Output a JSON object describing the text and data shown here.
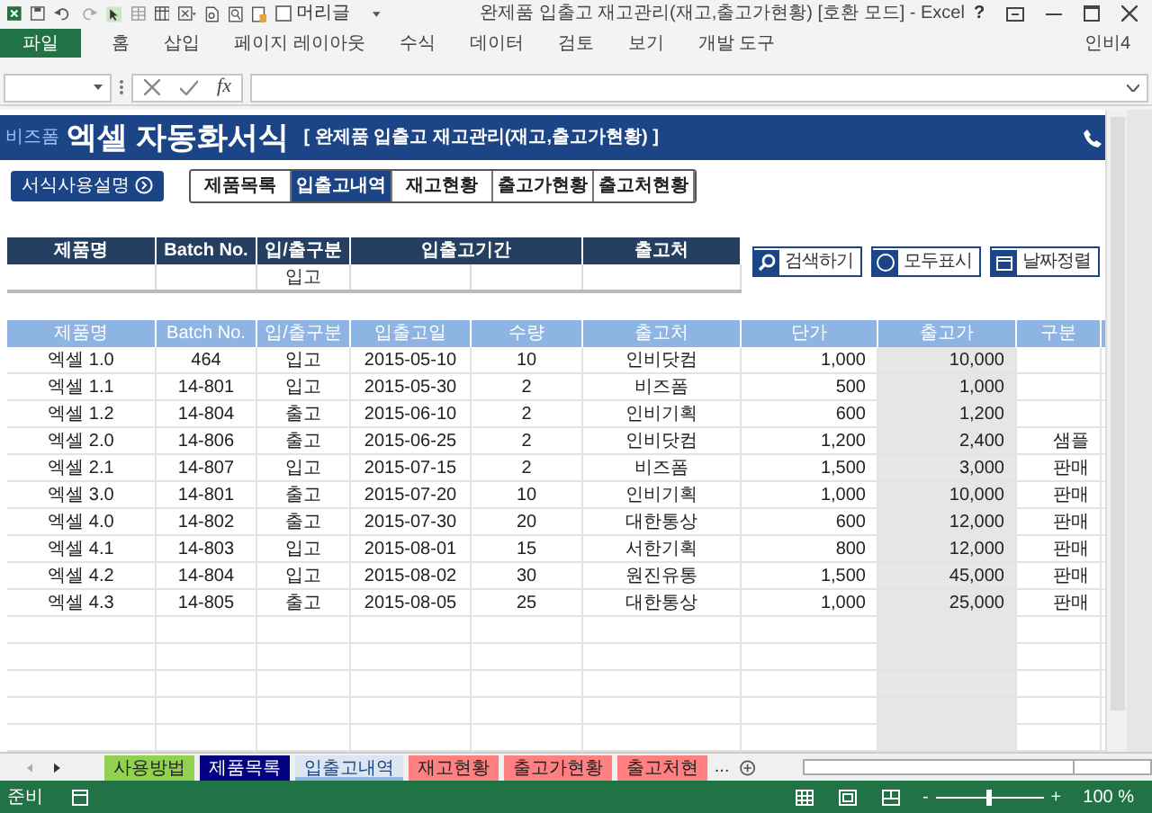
{
  "window": {
    "title": "완제품 입출고 재고관리(재고,출고가현황)  [호환 모드] - Excel",
    "quick_access": {
      "label": "머리글",
      "checked": false
    },
    "help": "?"
  },
  "ribbon": {
    "file_button": "파일",
    "tabs": [
      "홈",
      "삽입",
      "페이지 레이아웃",
      "수식",
      "데이터",
      "검토",
      "보기",
      "개발 도구"
    ],
    "account": "인비4"
  },
  "formula_bar": {
    "function_label": "fx"
  },
  "banner": {
    "logo": "비즈폼",
    "title": "엑셀 자동화서식",
    "subtitle": "[ 완제품 입출고 재고관리(재고,출고가현황) ]"
  },
  "guide_button": "서식사용설명",
  "nav_tabs": [
    {
      "label": "제품목록",
      "selected": false
    },
    {
      "label": "입출고내역",
      "selected": true
    },
    {
      "label": "재고현황",
      "selected": false
    },
    {
      "label": "출고가현황",
      "selected": false
    },
    {
      "label": "출고처현황",
      "selected": false
    }
  ],
  "search": {
    "columns": [
      "제품명",
      "Batch No.",
      "입/출구분",
      "입출고기간",
      "출고처"
    ],
    "in_out_value": "입고"
  },
  "action_buttons": [
    {
      "label": "검색하기",
      "kind": "search"
    },
    {
      "label": "모두표시",
      "kind": "all"
    },
    {
      "label": "날짜정렬",
      "kind": "date"
    }
  ],
  "table": {
    "columns": [
      "제품명",
      "Batch No.",
      "입/출구분",
      "입출고일",
      "수량",
      "출고처",
      "단가",
      "출고가",
      "구분"
    ],
    "rows": [
      {
        "product": "엑셀 1.0",
        "batch": "464",
        "in_out": "입고",
        "date": "2015-05-10",
        "qty": "10",
        "vendor": "인비닷컴",
        "unit_price": "1,000",
        "out_price": "10,000"
      },
      {
        "product": "엑셀 1.1",
        "batch": "14-801",
        "in_out": "입고",
        "date": "2015-05-30",
        "qty": "2",
        "vendor": "비즈폼",
        "unit_price": "500",
        "out_price": "1,000"
      },
      {
        "product": "엑셀 1.2",
        "batch": "14-804",
        "in_out": "출고",
        "date": "2015-06-10",
        "qty": "2",
        "vendor": "인비기획",
        "unit_price": "600",
        "out_price": "1,200"
      },
      {
        "product": "엑셀 2.0",
        "batch": "14-806",
        "in_out": "출고",
        "date": "2015-06-25",
        "qty": "2",
        "vendor": "인비닷컴",
        "unit_price": "1,200",
        "out_price": "2,400",
        "category": "샘플"
      },
      {
        "product": "엑셀 2.1",
        "batch": "14-807",
        "in_out": "입고",
        "date": "2015-07-15",
        "qty": "2",
        "vendor": "비즈폼",
        "unit_price": "1,500",
        "out_price": "3,000",
        "category": "판매"
      },
      {
        "product": "엑셀 3.0",
        "batch": "14-801",
        "in_out": "출고",
        "date": "2015-07-20",
        "qty": "10",
        "vendor": "인비기획",
        "unit_price": "1,000",
        "out_price": "10,000",
        "category": "판매"
      },
      {
        "product": "엑셀 4.0",
        "batch": "14-802",
        "in_out": "출고",
        "date": "2015-07-30",
        "qty": "20",
        "vendor": "대한통상",
        "unit_price": "600",
        "out_price": "12,000",
        "category": "판매"
      },
      {
        "product": "엑셀 4.1",
        "batch": "14-803",
        "in_out": "입고",
        "date": "2015-08-01",
        "qty": "15",
        "vendor": "서한기획",
        "unit_price": "800",
        "out_price": "12,000",
        "category": "판매"
      },
      {
        "product": "엑셀 4.2",
        "batch": "14-804",
        "in_out": "입고",
        "date": "2015-08-02",
        "qty": "30",
        "vendor": "원진유통",
        "unit_price": "1,500",
        "out_price": "45,000",
        "category": "판매"
      },
      {
        "product": "엑셀 4.3",
        "batch": "14-805",
        "in_out": "출고",
        "date": "2015-08-05",
        "qty": "25",
        "vendor": "대한통상",
        "unit_price": "1,000",
        "out_price": "25,000",
        "category": "판매"
      }
    ]
  },
  "sheet_tabs": [
    {
      "label": "사용방법",
      "color": "#92d050",
      "selected": false
    },
    {
      "label": "제품목록",
      "color": "#000080",
      "selected": false
    },
    {
      "label": "입출고내역",
      "color": "#8db4e2",
      "selected": true
    },
    {
      "label": "재고현황",
      "color": "#ff8080",
      "selected": false
    },
    {
      "label": "출고가현황",
      "color": "#ff8080",
      "selected": false
    },
    {
      "label": "출고처현",
      "color": "#ff8080",
      "selected": false
    }
  ],
  "sheet_more": "...",
  "status_bar": {
    "status": "준비",
    "zoom_out": "-",
    "zoom_slider": {
      "level": 0.5
    },
    "zoom_in": "+",
    "zoom": "100 %"
  }
}
